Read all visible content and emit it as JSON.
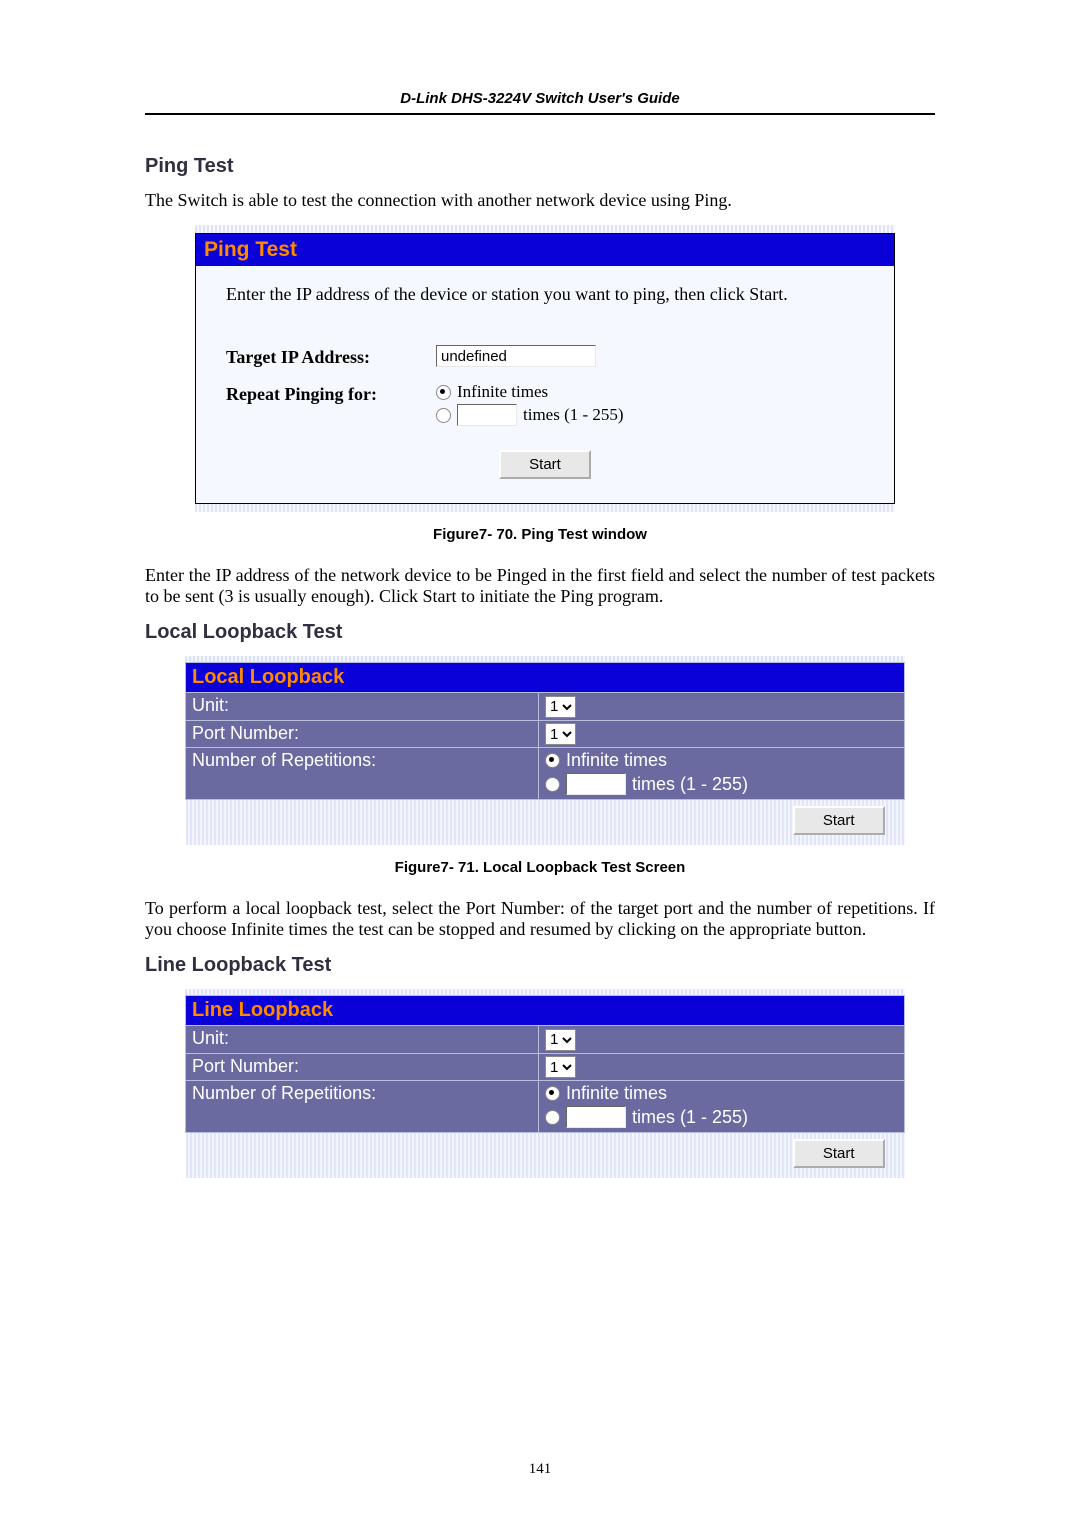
{
  "header": {
    "guide_title": "D-Link DHS-3224V Switch User's Guide"
  },
  "ping": {
    "section_title": "Ping Test",
    "intro": "The Switch is able to test the connection with another network device using Ping.",
    "panel_title": "Ping Test",
    "instruction": "Enter the IP address of the device or station you want to ping, then click Start.",
    "target_label": "Target IP Address:",
    "target_value": "undefined",
    "repeat_label": "Repeat Pinging for:",
    "opt_infinite": "Infinite times",
    "opt_count_suffix": "times (1 - 255)",
    "start_label": "Start",
    "figure_caption": "Figure7- 70.  Ping Test window",
    "post_text": "Enter the IP address of the network device to be Pinged in the first field and select the number of test packets to be sent (3 is usually enough). Click Start to initiate the Ping program."
  },
  "local": {
    "section_title": "Local Loopback Test",
    "panel_title": "Local Loopback",
    "rows": {
      "unit_label": "Unit:",
      "unit_value": "1",
      "port_label": "Port Number:",
      "port_value": "1",
      "rep_label": "Number of Repetitions:",
      "opt_infinite": "Infinite times",
      "opt_count_suffix": "times (1 - 255)"
    },
    "start_label": "Start",
    "figure_caption": "Figure7- 71. Local Loopback Test Screen",
    "post_text": "To perform a local loopback test, select the Port Number: of the target port and the number of repetitions. If you choose Infinite times the test can be stopped and resumed by clicking on the appropriate button."
  },
  "line": {
    "section_title": "Line Loopback Test",
    "panel_title": "Line Loopback",
    "rows": {
      "unit_label": "Unit:",
      "unit_value": "1",
      "port_label": "Port Number:",
      "port_value": "1",
      "rep_label": "Number of Repetitions:",
      "opt_infinite": "Infinite times",
      "opt_count_suffix": "times (1 - 255)"
    },
    "start_label": "Start"
  },
  "page_number": "141"
}
